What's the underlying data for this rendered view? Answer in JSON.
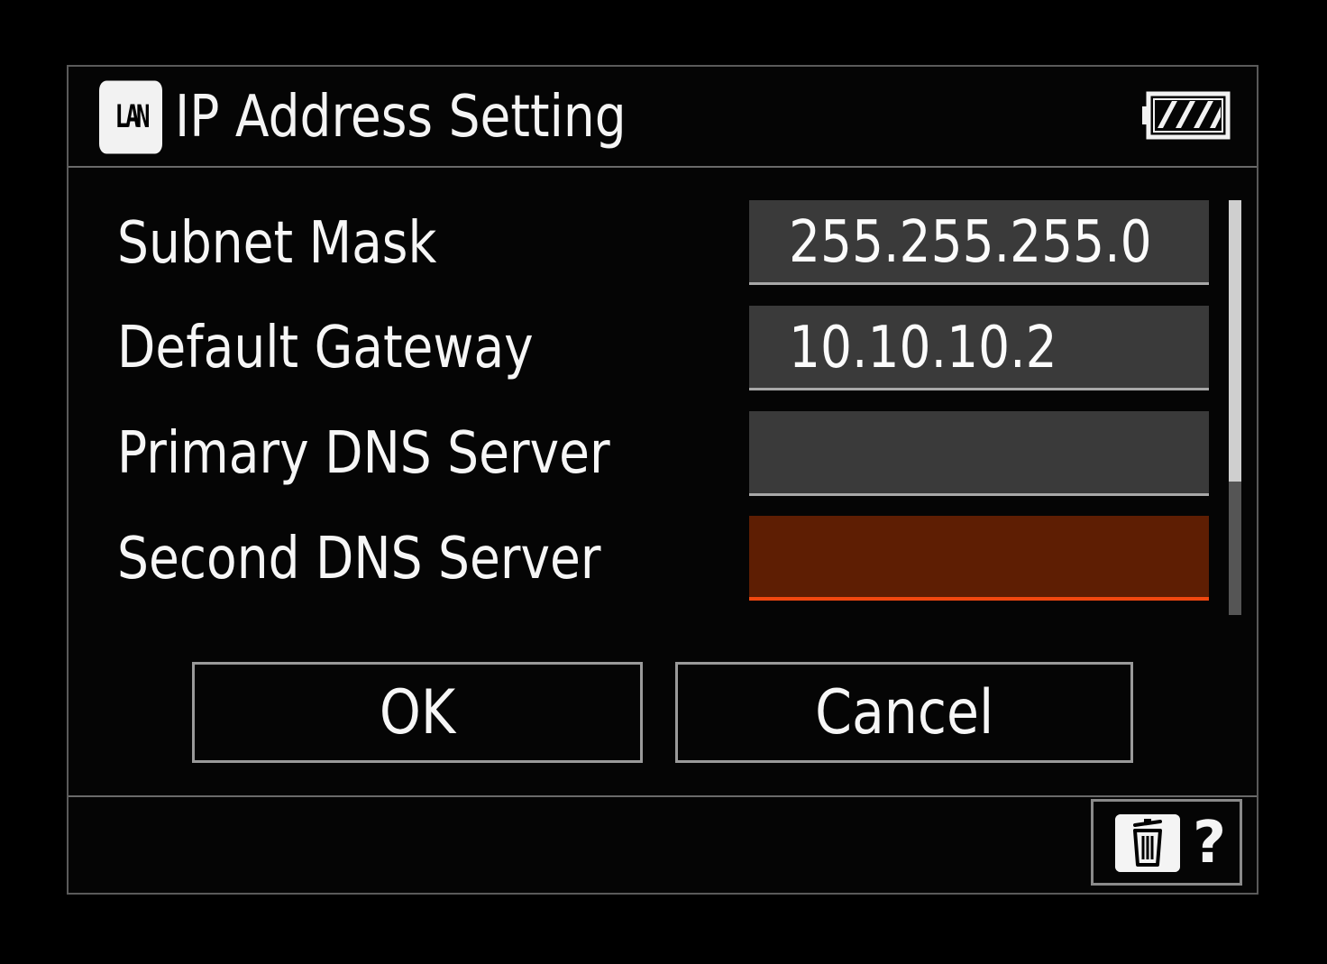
{
  "header": {
    "badge": "LAN",
    "title": "IP Address Setting",
    "battery_icon": "battery-full-icon"
  },
  "rows": [
    {
      "label": "Subnet Mask",
      "value": "255.255.255.0",
      "state": "normal"
    },
    {
      "label": "Default Gateway",
      "value": "10.10.10.2",
      "state": "normal"
    },
    {
      "label": "Primary DNS Server",
      "value": "",
      "state": "normal"
    },
    {
      "label": "Second DNS Server",
      "value": "",
      "state": "selected"
    }
  ],
  "buttons": {
    "ok_label": "OK",
    "cancel_label": "Cancel"
  },
  "footer": {
    "delete_icon": "trash-icon",
    "help_label": "?"
  },
  "colors": {
    "background": "#000000",
    "field": "#3a3a3a",
    "selected_field": "#5e1e03",
    "selected_accent": "#f04810"
  }
}
